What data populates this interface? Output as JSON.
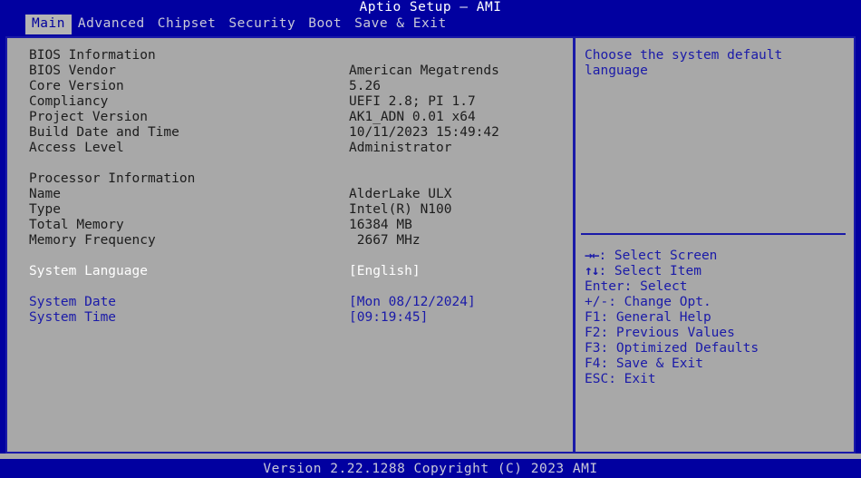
{
  "header": {
    "title": "Aptio Setup – AMI",
    "tabs": [
      {
        "label": "Main",
        "active": true
      },
      {
        "label": "Advanced",
        "active": false
      },
      {
        "label": "Chipset",
        "active": false
      },
      {
        "label": "Security",
        "active": false
      },
      {
        "label": "Boot",
        "active": false
      },
      {
        "label": "Save & Exit",
        "active": false
      }
    ]
  },
  "main": {
    "sections": [
      {
        "heading": "BIOS Information",
        "rows": [
          {
            "label": "BIOS Vendor",
            "value": "American Megatrends"
          },
          {
            "label": "Core Version",
            "value": "5.26"
          },
          {
            "label": "Compliancy",
            "value": "UEFI 2.8; PI 1.7"
          },
          {
            "label": "Project Version",
            "value": "AK1_ADN 0.01 x64"
          },
          {
            "label": "Build Date and Time",
            "value": "10/11/2023 15:49:42"
          },
          {
            "label": "Access Level",
            "value": "Administrator"
          }
        ]
      },
      {
        "heading": "Processor Information",
        "rows": [
          {
            "label": "Name",
            "value": "AlderLake ULX"
          },
          {
            "label": "Type",
            "value": "Intel(R) N100"
          },
          {
            "label": "Total Memory",
            "value": "16384 MB"
          },
          {
            "label": "Memory Frequency",
            "value": " 2667 MHz"
          }
        ]
      }
    ],
    "settings": [
      {
        "label": "System Language",
        "value": "[English]",
        "selected": true
      },
      {
        "label": "System Date",
        "value": "[Mon 08/12/2024]",
        "selected": false
      },
      {
        "label": "System Time",
        "value": "[09:19:45]",
        "selected": false
      }
    ]
  },
  "help": {
    "text_lines": [
      "Choose the system default",
      "language"
    ],
    "keys": [
      {
        "glyph": "→←",
        "text": ": Select Screen"
      },
      {
        "glyph": "↑↓",
        "text": ": Select Item"
      },
      {
        "glyph": "",
        "text": "Enter: Select"
      },
      {
        "glyph": "",
        "text": "+/-: Change Opt."
      },
      {
        "glyph": "",
        "text": "F1: General Help"
      },
      {
        "glyph": "",
        "text": "F2: Previous Values"
      },
      {
        "glyph": "",
        "text": "F3: Optimized Defaults"
      },
      {
        "glyph": "",
        "text": "F4: Save & Exit"
      },
      {
        "glyph": "",
        "text": "ESC: Exit"
      }
    ]
  },
  "footer": {
    "text": "Version 2.22.1288 Copyright (C) 2023 AMI"
  },
  "colors": {
    "header_blue": "#0100a0",
    "body_gray": "#a8a8a8",
    "text_blue": "#1a1aa8",
    "text_dark": "#1c1c1c",
    "text_white": "#ffffff",
    "tab_active_bg": "#b4b4b4"
  }
}
